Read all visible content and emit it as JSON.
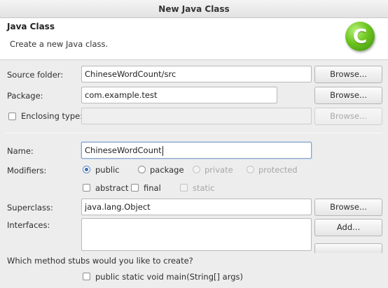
{
  "window": {
    "title": "New Java Class"
  },
  "header": {
    "title": "Java Class",
    "description": "Create a new Java class.",
    "logo_icon": "java-class-wizard-icon",
    "logo_letter": "C",
    "logo_color": "#6cc51e"
  },
  "source_folder": {
    "label": "Source folder:",
    "value": "ChineseWordCount/src",
    "browse_label": "Browse..."
  },
  "package": {
    "label": "Package:",
    "value": "com.example.test",
    "browse_label": "Browse..."
  },
  "enclosing_type": {
    "label": "Enclosing type:",
    "checked": false,
    "value": "",
    "browse_label": "Browse..."
  },
  "name": {
    "label": "Name:",
    "value": "ChineseWordCount"
  },
  "modifiers": {
    "label": "Modifiers:",
    "access": [
      {
        "label": "public",
        "selected": true,
        "enabled": true
      },
      {
        "label": "package",
        "selected": false,
        "enabled": true
      },
      {
        "label": "private",
        "selected": false,
        "enabled": false
      },
      {
        "label": "protected",
        "selected": false,
        "enabled": false
      }
    ],
    "flags": [
      {
        "label": "abstract",
        "checked": false,
        "enabled": true
      },
      {
        "label": "final",
        "checked": false,
        "enabled": true
      },
      {
        "label": "static",
        "checked": false,
        "enabled": false
      }
    ]
  },
  "superclass": {
    "label": "Superclass:",
    "value": "java.lang.Object",
    "browse_label": "Browse..."
  },
  "interfaces": {
    "label": "Interfaces:",
    "add_label": "Add..."
  },
  "method_stubs": {
    "question": "Which method stubs would you like to create?",
    "options": [
      {
        "label": "public static void main(String[] args)",
        "checked": false
      }
    ]
  }
}
